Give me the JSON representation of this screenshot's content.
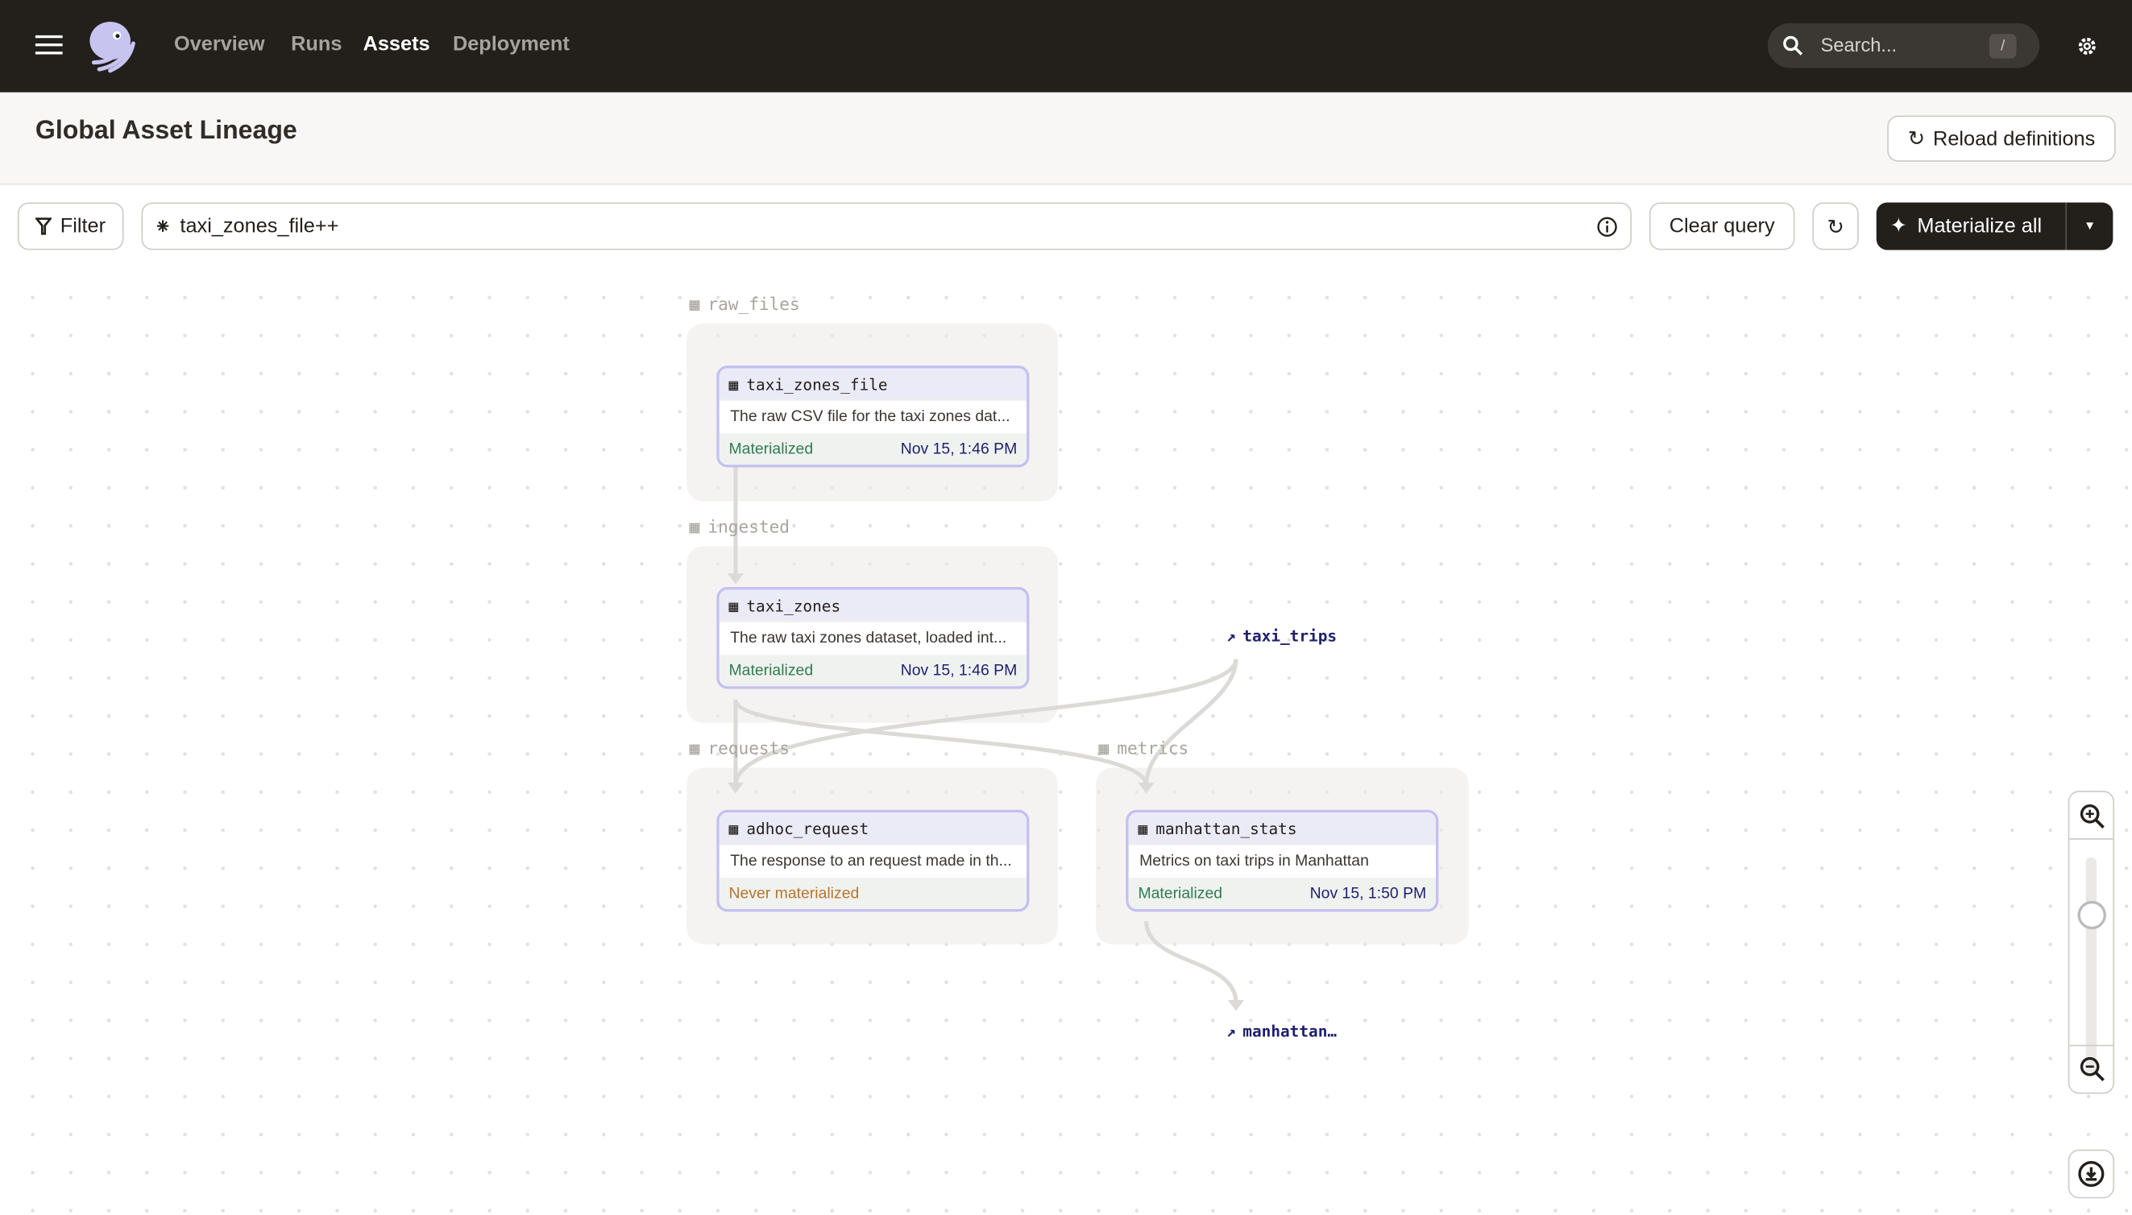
{
  "nav": {
    "items": [
      "Overview",
      "Runs",
      "Assets",
      "Deployment"
    ],
    "active": "Assets",
    "search_placeholder": "Search...",
    "search_shortcut": "/"
  },
  "header": {
    "title": "Global Asset Lineage",
    "reload_label": "Reload definitions"
  },
  "toolbar": {
    "filter_label": "Filter",
    "query_value": "taxi_zones_file++",
    "clear_label": "Clear query",
    "materialize_label": "Materialize all"
  },
  "graph": {
    "groups": [
      {
        "name": "raw_files"
      },
      {
        "name": "ingested"
      },
      {
        "name": "requests"
      },
      {
        "name": "metrics"
      }
    ],
    "nodes": [
      {
        "name": "taxi_zones_file",
        "description": "The raw CSV file for the taxi zones dat...",
        "status": "Materialized",
        "timestamp": "Nov 15, 1:46 PM"
      },
      {
        "name": "taxi_zones",
        "description": "The raw taxi zones dataset, loaded int...",
        "status": "Materialized",
        "timestamp": "Nov 15, 1:46 PM"
      },
      {
        "name": "adhoc_request",
        "description": "The response to an request made in th...",
        "status": "Never materialized",
        "timestamp": ""
      },
      {
        "name": "manhattan_stats",
        "description": "Metrics on taxi trips in Manhattan",
        "status": "Materialized",
        "timestamp": "Nov 15, 1:50 PM"
      }
    ],
    "external": [
      {
        "name": "taxi_trips"
      },
      {
        "name": "manhattan…"
      }
    ]
  },
  "zoom": {
    "level": 0.75
  },
  "colors": {
    "topbar": "#231f1b",
    "materialized": "#2e7d4f",
    "never": "#b7762b",
    "node_border": "#c5c0ef",
    "primary_button": "#231f1b"
  }
}
